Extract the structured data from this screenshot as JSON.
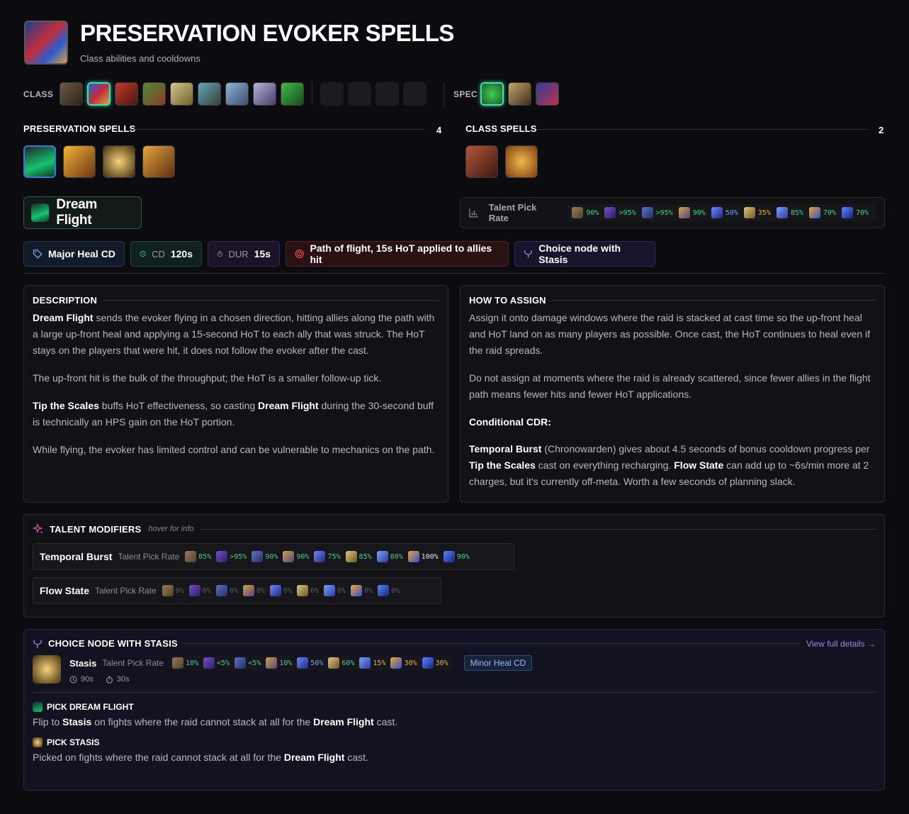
{
  "header": {
    "title": "PRESERVATION EVOKER SPELLS",
    "subtitle": "Class abilities and cooldowns"
  },
  "nav": {
    "class_label": "CLASS",
    "spec_label": "SPEC"
  },
  "sections": {
    "preservation": {
      "title": "PRESERVATION SPELLS",
      "count": "4"
    },
    "class": {
      "title": "CLASS SPELLS",
      "count": "2"
    }
  },
  "spell": {
    "name": "Dream Flight"
  },
  "pickrate": {
    "label": "Talent Pick Rate",
    "values": [
      "90%",
      ">95%",
      ">95%",
      "90%",
      "50%",
      "35%",
      "85%",
      "70%",
      "70%"
    ]
  },
  "tags": {
    "role": "Major Heal CD",
    "cd_key": "CD",
    "cd_val": "120s",
    "dur_key": "DUR",
    "dur_val": "15s",
    "target": "Path of flight, 15s HoT applied to allies hit",
    "choice": "Choice node with Stasis"
  },
  "description": {
    "title": "DESCRIPTION",
    "p1_b": "Dream Flight",
    "p1": " sends the evoker flying in a chosen direction, hitting allies along the path with a large up-front heal and applying a 15-second HoT to each ally that was struck. The HoT stays on the players that were hit, it does not follow the evoker after the cast.",
    "p2": "The up-front hit is the bulk of the throughput; the HoT is a smaller follow-up tick.",
    "p3_b1": "Tip the Scales",
    "p3_a": " buffs HoT effectiveness, so casting ",
    "p3_b2": "Dream Flight",
    "p3_c": " during the 30-second buff is technically an HPS gain on the HoT portion.",
    "p4": "While flying, the evoker has limited control and can be vulnerable to mechanics on the path."
  },
  "assign": {
    "title": "HOW TO ASSIGN",
    "p1": "Assign it onto damage windows where the raid is stacked at cast time so the up-front heal and HoT land on as many players as possible. Once cast, the HoT continues to heal even if the raid spreads.",
    "p2": "Do not assign at moments where the raid is already scattered, since fewer allies in the flight path means fewer hits and fewer HoT applications.",
    "p3": "Conditional CDR:",
    "p4_b1": "Temporal Burst",
    "p4_a": " (Chronowarden) gives about 4.5 seconds of bonus cooldown progress per ",
    "p4_b2": "Tip the Scales",
    "p4_c": " cast on everything recharging. ",
    "p4_b3": "Flow State",
    "p4_d": " can add up to ~6s/min more at 2 charges, but it's currently off-meta. Worth a few seconds of planning slack."
  },
  "modifiers": {
    "title": "TALENT MODIFIERS",
    "hint": "hover for info",
    "rows": [
      {
        "name": "Temporal Burst",
        "label": "Talent Pick Rate",
        "values": [
          "85%",
          ">95%",
          "90%",
          "90%",
          "75%",
          "85%",
          "80%",
          "100%",
          "90%"
        ]
      },
      {
        "name": "Flow State",
        "label": "Talent Pick Rate",
        "values": [
          "0%",
          "0%",
          "0%",
          "0%",
          "0%",
          "0%",
          "0%",
          "0%",
          "0%"
        ]
      }
    ]
  },
  "choice": {
    "title": "CHOICE NODE WITH STASIS",
    "link": "View full details →",
    "spell": "Stasis",
    "label": "Talent Pick Rate",
    "values": [
      "10%",
      "<5%",
      "<5%",
      "10%",
      "50%",
      "60%",
      "15%",
      "30%",
      "30%"
    ],
    "tag": "Minor Heal CD",
    "cd": "90s",
    "dur": "30s",
    "pick1_title": "PICK DREAM FLIGHT",
    "pick1_a": "Flip to ",
    "pick1_b1": "Stasis",
    "pick1_c": " on fights where the raid cannot stack at all for the ",
    "pick1_b2": "Dream Flight",
    "pick1_d": " cast.",
    "pick2_title": "PICK STASIS",
    "pick2_a": "Picked on fights where the raid cannot stack at all for the ",
    "pick2_b": "Dream Flight",
    "pick2_c": " cast."
  }
}
